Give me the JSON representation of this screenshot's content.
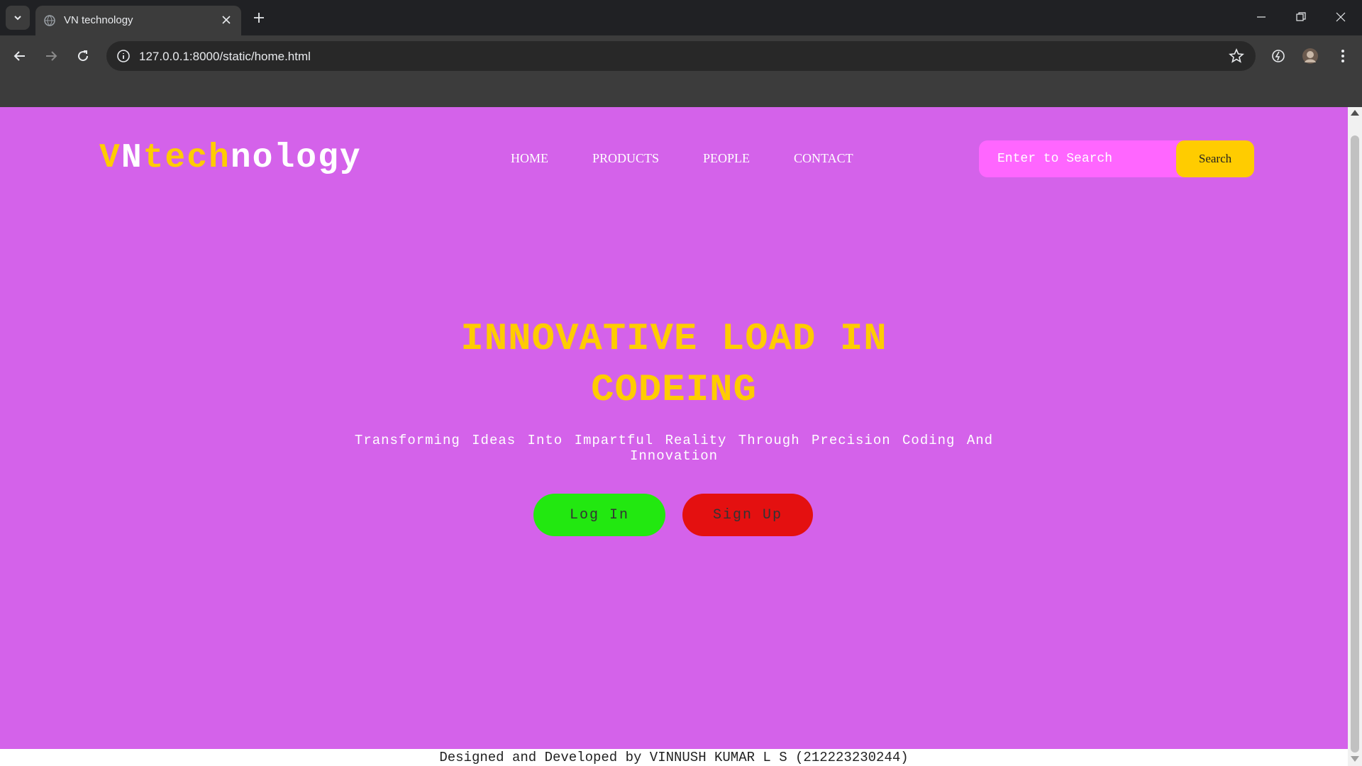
{
  "browser": {
    "tab_title": "VN technology",
    "url": "127.0.0.1:8000/static/home.html"
  },
  "site": {
    "logo": {
      "part1": "VN",
      "part2": "tech",
      "part3": "nology",
      "colors": {
        "V": "#ffcc00",
        "N": "#ffffff",
        "tech": "#ffcc00",
        "nology": "#ffffff"
      }
    },
    "nav": [
      "HOME",
      "PRODUCTS",
      "PEOPLE",
      "CONTACT"
    ],
    "search": {
      "placeholder": "Enter to Search",
      "button_label": "Search"
    },
    "hero": {
      "title_line1": "INNOVATIVE LOAD IN",
      "title_line2": "CODEING",
      "subtitle_line1": "Transforming Ideas Into Impartful Reality Through Precision Coding And",
      "subtitle_line2": "Innovation"
    },
    "buttons": {
      "login": "Log In",
      "signup": "Sign Up"
    },
    "footer": "Designed and Developed by VINNUSH KUMAR L S (212223230244)",
    "colors": {
      "background": "#d462ea",
      "accent": "#ffcc00",
      "search_field": "#ff66ff",
      "login": "#22e810",
      "signup": "#e41010"
    }
  }
}
